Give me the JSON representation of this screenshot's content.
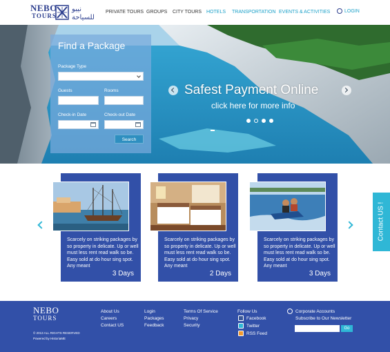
{
  "header": {
    "logo_name": "NEBO",
    "logo_sub": "TOURS",
    "logo_arabic": "نيبو للسياحة",
    "nav": [
      {
        "label": "PRIVATE TOURS",
        "style": "dark"
      },
      {
        "label": "GROUPS",
        "style": "dark"
      },
      {
        "label": "CITY TOURS",
        "style": "dark"
      },
      {
        "label": "HOTELS",
        "style": "blue"
      },
      {
        "label": "TRANSPORTATION",
        "style": "blue"
      },
      {
        "label": "EVENTS & ACTIVITIES",
        "style": "blue"
      }
    ],
    "login_label": "LOGIN"
  },
  "find_package": {
    "title": "Find a Package",
    "package_type_label": "Package Type",
    "package_type_value": "",
    "guests_label": "Guests",
    "rooms_label": "Rooms",
    "checkin_label": "Check-in Date",
    "checkout_label": "Check-out Date",
    "search_label": "Search"
  },
  "slider": {
    "title": "Safest Payment Online",
    "subtitle": "click here for more info",
    "slide_count": 4,
    "active_slide": 1
  },
  "packages": [
    {
      "image": "harbor-ship-photo",
      "description": "Scarcely on striking packages by so property in delicate. Up or well must less rent read walk so be. Easy sold at do hour sing spot. Any meant",
      "duration": "3 Days"
    },
    {
      "image": "hotel-room-photo",
      "description": "Scarcely on striking packages by so property in delicate. Up or well must less rent read walk so be. Easy sold at do hour sing spot. Any meant",
      "duration": "2 Days"
    },
    {
      "image": "jet-ski-photo",
      "description": "Scarcely on striking packages by so property in delicate. Up or well must less rent read walk so be. Easy sold at do hour sing spot. Any meant",
      "duration": "3 Days"
    }
  ],
  "contact_tab": "Contact US !",
  "footer": {
    "logo_name": "NEBO",
    "logo_sub": "TOURS",
    "copyright": "© 2013 ALL RIGHTS RESERVED",
    "powered": "Powered by HistoriaME",
    "col1": [
      "About Us",
      "Careers",
      "Contact US"
    ],
    "col2": [
      "Login",
      "Packages",
      "Feedback"
    ],
    "col3": [
      "Terms Of Service",
      "Privacy",
      "Security"
    ],
    "follow_title": "Follow Us",
    "social": [
      "Facebook",
      "Twitter",
      "RSS Feed"
    ],
    "corporate": "Corporate Accounts",
    "newsletter_title": "Subscribe to Our Newsletter",
    "newsletter_placeholder": "",
    "go_label": "Go"
  },
  "colors": {
    "brand_blue": "#3250a8",
    "accent_cyan": "#2fb7d6",
    "nav_blue": "#1aa0c8"
  }
}
